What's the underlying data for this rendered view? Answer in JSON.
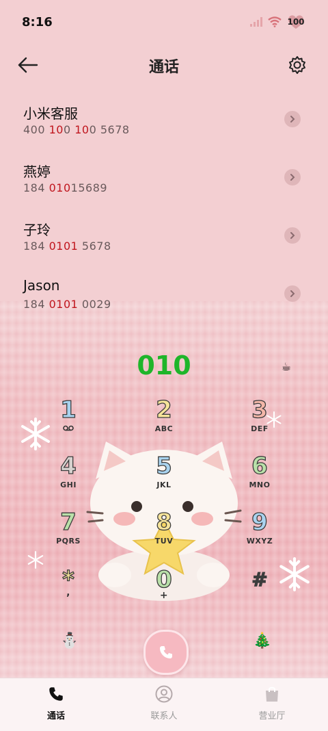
{
  "status_bar": {
    "time": "8:16",
    "battery": "100"
  },
  "header": {
    "title": "通话",
    "back_icon": "back-arrow-icon",
    "settings_icon": "gear-icon"
  },
  "contacts": [
    {
      "name": "小米客服",
      "number_parts": [
        "400 ",
        "10",
        "0 ",
        "10",
        "0 5678"
      ]
    },
    {
      "name": "燕婷",
      "number_parts": [
        "184 ",
        "010",
        "15689"
      ]
    },
    {
      "name": "子玲",
      "number_parts": [
        "184 ",
        "0101",
        " 5678"
      ]
    },
    {
      "name": "Jason",
      "number_parts": [
        "184 ",
        "0101",
        " 0029"
      ]
    }
  ],
  "dialer": {
    "entered": "010",
    "keys": [
      {
        "digit": "1",
        "letters": "",
        "color": "#a9d3ef"
      },
      {
        "digit": "2",
        "letters": "ABC",
        "color": "#f6e49a"
      },
      {
        "digit": "3",
        "letters": "DEF",
        "color": "#f3b6a8"
      },
      {
        "digit": "4",
        "letters": "GHI",
        "color": "#d7d2cf"
      },
      {
        "digit": "5",
        "letters": "JKL",
        "color": "#a9d3ef"
      },
      {
        "digit": "6",
        "letters": "MNO",
        "color": "#b9e0a9"
      },
      {
        "digit": "7",
        "letters": "PQRS",
        "color": "#b9e0a9"
      },
      {
        "digit": "8",
        "letters": "TUV",
        "color": "#f6e49a"
      },
      {
        "digit": "9",
        "letters": "WXYZ",
        "color": "#a9d3ef"
      },
      {
        "digit": "*",
        "letters": ",",
        "color": "#f6e49a"
      },
      {
        "digit": "0",
        "letters": "+",
        "color": "#b9e0a9"
      },
      {
        "digit": "#",
        "letters": "",
        "color": "#3c3c3c"
      }
    ]
  },
  "bottom_nav": [
    {
      "label": "通话",
      "icon": "phone-icon",
      "active": true
    },
    {
      "label": "联系人",
      "icon": "contact-icon",
      "active": false
    },
    {
      "label": "营业厅",
      "icon": "shopping-bag-icon",
      "active": false
    }
  ],
  "colors": {
    "accent_green": "#1fb52a",
    "highlight_red": "#c0161e",
    "background_pink": "#f3cfd2"
  }
}
